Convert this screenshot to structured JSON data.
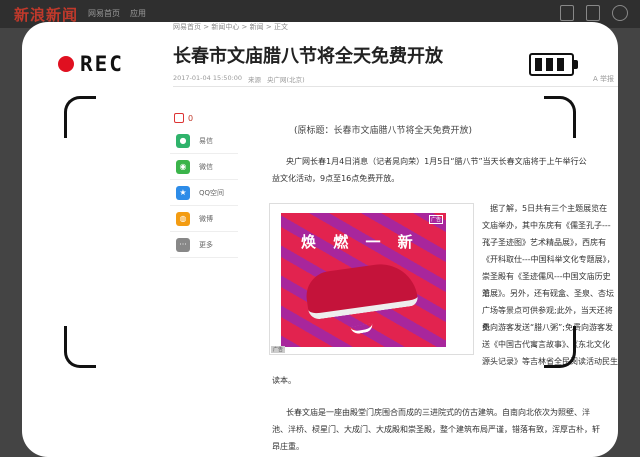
{
  "nav": {
    "logo": "新浪新闻",
    "links": [
      "网易首页",
      "应用"
    ]
  },
  "breadcrumb": "网易首页 > 新闻中心 > 新闻 > 正文",
  "article": {
    "title": "长春市文庙腊八节将全天免费开放",
    "time": "2017-01-04 15:50:00",
    "source_label": "来源",
    "source": "央广网(北京)",
    "fontsize_label": "A 举报",
    "original_title": "(原标题：长春市文庙腊八节将全天免费开放)",
    "para1_line1": "央广网长春1月4日消息（记者晁向荣）1月5日“腊八节”当天长春文庙将于上午举行公",
    "para1_line2": "益文化活动，9点至16点免费开放。",
    "para2_lines": [
      "据了解，5日共有三个主题展览在",
      "文庙举办，其中东庑有《儒圣孔子---《",
      "孔子圣迹图》艺术精品展》，西庑有",
      "《开科取仕---中国科举文化专题展》，",
      "崇圣殿有《圣迹儒风---中国文庙历史沿",
      "革展》。另外，还有砚盒、圣泉、杏坛",
      "广场等景点可供参观;此外，当天还将免",
      "费向游客发送“腊八粥”;免费向游客发",
      "送《中国古代寓言故事》、《东北文化",
      "源头记录》等吉林省全民阅读活动民生"
    ],
    "para2_end": "读本。",
    "para3_line1": "长春文庙是一座由殿堂门庑围合而成的三进院式的仿古建筑。自南向北依次为照壁、泮",
    "para3_line2": "池、泮桥、棂星门、大成门、大成殿和崇圣殿，整个建筑布局严谨，错落有致，浑厚古朴，轩",
    "para3_line3": "昂庄重。"
  },
  "share": {
    "comment_count": "0",
    "items": [
      {
        "label": "易信",
        "color": "#2fb36b",
        "icon": "yixin-icon"
      },
      {
        "label": "微信",
        "color": "#3bb44a",
        "icon": "wechat-icon"
      },
      {
        "label": "QQ空间",
        "color": "#2d8ce8",
        "icon": "qzone-icon"
      },
      {
        "label": "微博",
        "color": "#f39c12",
        "icon": "weibo-icon"
      },
      {
        "label": "更多",
        "color": "#888888",
        "icon": "more-icon"
      }
    ]
  },
  "ad": {
    "slogan": "焕 燃 一 新",
    "tag": "广告",
    "label": "广告"
  },
  "overlay": {
    "rec_label": "REC",
    "rec_color": "#e01020",
    "battery_level": 1.0
  }
}
